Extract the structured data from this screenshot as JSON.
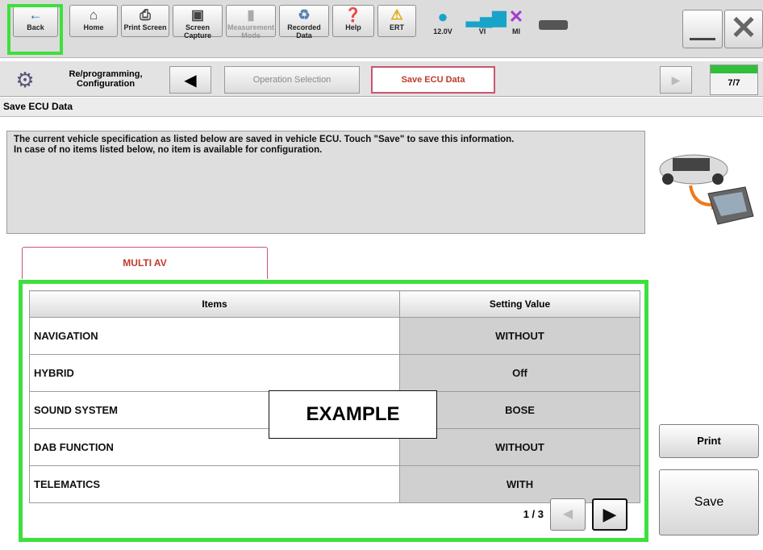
{
  "toolbar": {
    "back": "Back",
    "home": "Home",
    "print_screen": "Print Screen",
    "screen_capture": "Screen Capture",
    "measurement_mode": "Measurement Mode",
    "recorded_data": "Recorded Data",
    "help": "Help",
    "ert": "ERT",
    "voltage": "12.0V",
    "vi": "VI",
    "mi": "MI"
  },
  "nav": {
    "reprogramming": "Re/programming, Configuration",
    "operation_selection": "Operation Selection",
    "save_ecu_data": "Save ECU Data",
    "progress": "7/7"
  },
  "page": {
    "title": "Save ECU Data",
    "message_line1": "The current vehicle specification as listed below are saved in vehicle ECU. Touch \"Save\" to save this information.",
    "message_line2": "In case of no items listed below, no item is available for configuration.",
    "tab_label": "MULTI AV"
  },
  "table": {
    "headers": [
      "Items",
      "Setting Value"
    ],
    "rows": [
      {
        "item": "NAVIGATION",
        "value": "WITHOUT"
      },
      {
        "item": "HYBRID",
        "value": "Off"
      },
      {
        "item": "SOUND SYSTEM",
        "value": "BOSE"
      },
      {
        "item": "DAB FUNCTION",
        "value": "WITHOUT"
      },
      {
        "item": "TELEMATICS",
        "value": "WITH"
      }
    ],
    "page_indicator": "1 / 3"
  },
  "overlay": {
    "example": "EXAMPLE"
  },
  "buttons": {
    "print": "Print",
    "save": "Save"
  },
  "colors": {
    "highlight": "#3de03d",
    "active_tab": "#c8566f"
  }
}
